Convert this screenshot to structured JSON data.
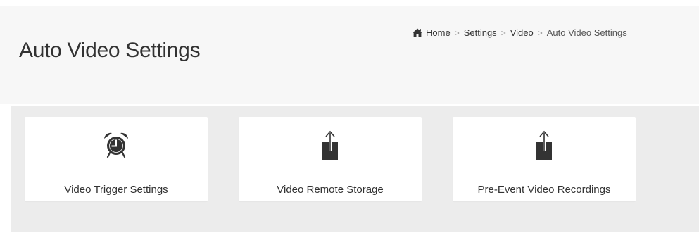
{
  "page": {
    "title": "Auto Video Settings"
  },
  "breadcrumb": {
    "home_icon": "home-icon",
    "items": [
      "Home",
      "Settings",
      "Video",
      "Auto Video Settings"
    ],
    "separator": ">"
  },
  "tiles": [
    {
      "label": "Video Trigger Settings",
      "icon": "alarm-clock-icon"
    },
    {
      "label": "Video Remote Storage",
      "icon": "upload-icon"
    },
    {
      "label": "Pre-Event Video Recordings",
      "icon": "upload-icon"
    }
  ],
  "colors": {
    "header_background": "#f7f7f7",
    "panel_background": "#ececec",
    "tile_background": "#ffffff",
    "icon": "#333333",
    "text": "#333333"
  }
}
